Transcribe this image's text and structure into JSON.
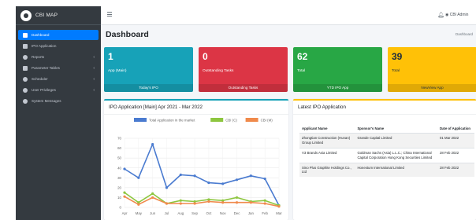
{
  "app": {
    "brand": "CBI MAP"
  },
  "sidebar": {
    "items": [
      {
        "label": "Dashboard",
        "icon": "dashboard-icon",
        "active": true
      },
      {
        "label": "IPO Application",
        "icon": "file-icon"
      },
      {
        "label": "Reports",
        "icon": "chart-pie-icon",
        "caret": "‹"
      },
      {
        "label": "Parameter Tables",
        "icon": "tools-icon",
        "caret": "‹"
      },
      {
        "label": "Scheduler",
        "icon": "clock-icon",
        "caret": "‹"
      },
      {
        "label": "User Privileges",
        "icon": "user-icon",
        "caret": "‹"
      },
      {
        "label": "System Messages",
        "icon": "bell-icon"
      }
    ]
  },
  "header": {
    "user_label": "CBI Admin"
  },
  "page": {
    "title": "Dashboard",
    "breadcrumb": "Dashboard"
  },
  "stat_boxes": [
    {
      "value": "1",
      "label": "App (Main)",
      "footer": "Today's IPO",
      "color": "#17a2b8"
    },
    {
      "value": "0",
      "label": "Outstanding Tasks",
      "footer": "Outstanding Tasks",
      "color": "#dc3545"
    },
    {
      "value": "62",
      "label": "Total",
      "footer": "YTD IPO App",
      "color": "#28a745"
    },
    {
      "value": "39",
      "label": "Total",
      "footer": "NewView App",
      "color": "#ffc107"
    }
  ],
  "chart_panel": {
    "title": "IPO Application [Main] Apr 2021 - Mar 2022"
  },
  "chart_data": {
    "type": "line",
    "categories": [
      "Apr",
      "May",
      "Jun",
      "Jul",
      "Aug",
      "Sep",
      "Oct",
      "Nov",
      "Dec",
      "Jan",
      "Feb",
      "Mar"
    ],
    "ylim": [
      0,
      70
    ],
    "yticks": [
      0,
      10,
      20,
      30,
      40,
      50,
      60,
      70
    ],
    "series": [
      {
        "name": "Total Application in the market",
        "color": "#4a7bd0",
        "values": [
          39,
          30,
          64,
          20,
          33,
          32,
          25,
          24,
          28,
          32,
          29,
          2
        ]
      },
      {
        "name": "CBI (C)",
        "color": "#8dc63f",
        "values": [
          15,
          5,
          14,
          4,
          7,
          6,
          8,
          7,
          10,
          6,
          7,
          2
        ]
      },
      {
        "name": "CBI (M)",
        "color": "#f08a4b",
        "values": [
          11,
          3,
          10,
          4,
          4,
          4,
          6,
          5,
          5,
          5,
          4,
          1
        ]
      }
    ]
  },
  "latest_panel": {
    "title": "Latest IPO Application",
    "headers": [
      "Applicant Name",
      "Sponsor's Name",
      "Date of Application"
    ],
    "rows": [
      {
        "applicant": "Zhongtian Construction (Hunan) Group Limited",
        "sponsor": "Grande Capital Limited",
        "date": "01 Mar 2022"
      },
      {
        "applicant": "V3 Brands Asia Limited",
        "sponsor": "Goldman Sachs (Asia) L.L.C.; China International Capital Corporation Hong Kong Securities Limited",
        "date": "28 Feb 2022"
      },
      {
        "applicant": "Sino Plus Graphite Holdings Co., Ltd",
        "sponsor": "Honestum International Limited",
        "date": "28 Feb 2022"
      }
    ]
  }
}
